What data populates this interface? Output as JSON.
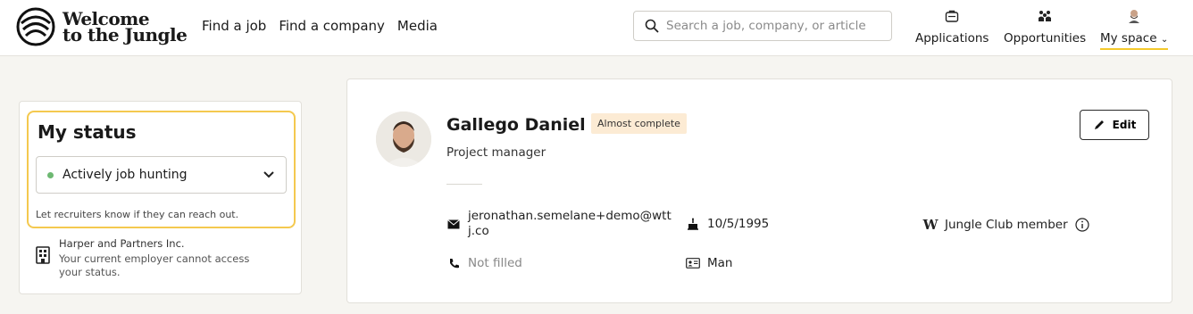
{
  "brand": {
    "line1": "Welcome",
    "line2": "to the Jungle"
  },
  "nav": {
    "find_job": "Find a job",
    "find_company": "Find a company",
    "media": "Media"
  },
  "search": {
    "placeholder": "Search a job, company, or article"
  },
  "header_nav": {
    "applications": "Applications",
    "opportunities": "Opportunities",
    "my_space": "My space"
  },
  "status": {
    "title": "My status",
    "selected": "Actively job hunting",
    "hint": "Let recruiters know if they can reach out.",
    "employer_name": "Harper and Partners Inc.",
    "employer_note": "Your current employer cannot access your status."
  },
  "profile": {
    "name": "Gallego Daniel",
    "badge": "Almost complete",
    "job_title": "Project manager",
    "edit_label": "Edit",
    "email": "jeronathan.semelane+demo@wttj.co",
    "birthdate": "10/5/1995",
    "club": "Jungle Club member",
    "phone": "Not filled",
    "gender": "Man"
  },
  "colors": {
    "accent": "#f4c92b",
    "status_border": "#f4c94f",
    "badge_bg": "#fcebd4",
    "status_dot": "#6db872",
    "page_bg": "#f6f5f1"
  },
  "icons": [
    "welcome-logo-icon",
    "search-icon",
    "briefcase-icon",
    "people-icon",
    "avatar-icon",
    "chevron-down-icon",
    "building-icon",
    "pencil-icon",
    "mail-icon",
    "cake-icon",
    "jungle-w-icon",
    "info-icon",
    "phone-icon",
    "id-card-icon"
  ]
}
